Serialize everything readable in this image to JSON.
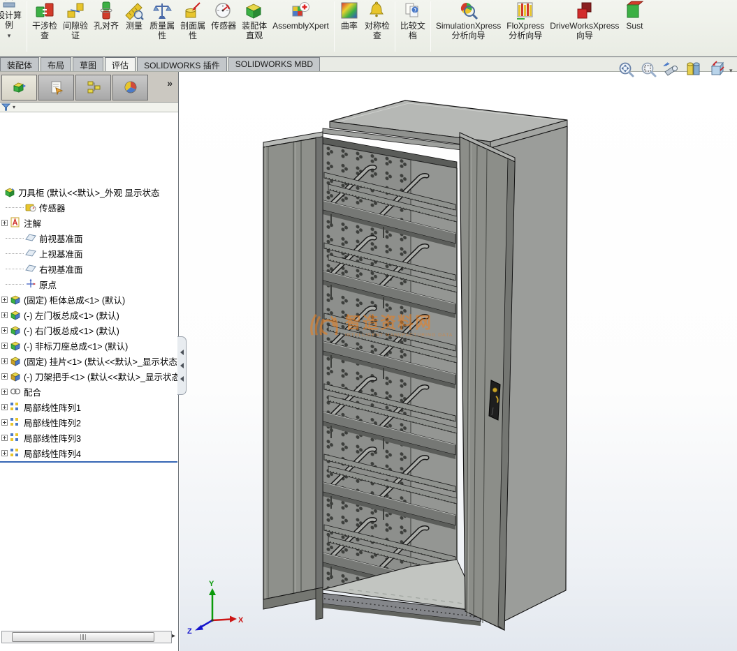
{
  "ribbon": {
    "caret": "▾",
    "items": [
      {
        "label": "设计算\n例"
      },
      {
        "label": "干涉检\n查"
      },
      {
        "label": "间隙验\n证"
      },
      {
        "label": "孔对齐"
      },
      {
        "label": "测量"
      },
      {
        "label": "质量属\n性"
      },
      {
        "label": "剖面属\n性"
      },
      {
        "label": "传感器"
      },
      {
        "label": "装配体\n直观"
      },
      {
        "label": "AssemblyXpert"
      },
      {
        "label": "曲率"
      },
      {
        "label": "对称检\n查"
      },
      {
        "label": "比较文\n档"
      },
      {
        "label": "SimulationXpress\n分析向导"
      },
      {
        "label": "FloXpress\n分析向导"
      },
      {
        "label": "DriveWorksXpress\n向导"
      },
      {
        "label": "Sust"
      }
    ]
  },
  "tabs": {
    "items": [
      "装配体",
      "布局",
      "草图",
      "评估",
      "SOLIDWORKS 插件",
      "SOLIDWORKS MBD"
    ],
    "active": "评估"
  },
  "panel": {
    "overflow_chevron": "»",
    "filter_caret": "▾"
  },
  "tree": {
    "items": [
      {
        "label": "刀具柜 (默认<<默认>_外观 显示状态",
        "icon": "assembly-root",
        "expander": false
      },
      {
        "label": "传感器",
        "icon": "sensors-folder",
        "expander": false
      },
      {
        "label": "注解",
        "icon": "annotations",
        "expander": true
      },
      {
        "label": "前视基准面",
        "icon": "plane",
        "expander": false
      },
      {
        "label": "上视基准面",
        "icon": "plane",
        "expander": false
      },
      {
        "label": "右视基准面",
        "icon": "plane",
        "expander": false
      },
      {
        "label": "原点",
        "icon": "origin",
        "expander": false
      },
      {
        "label": "(固定) 柜体总成<1> (默认)",
        "icon": "subassembly",
        "expander": true
      },
      {
        "label": "(-) 左门板总成<1> (默认)",
        "icon": "subassembly",
        "expander": true
      },
      {
        "label": "(-) 右门板总成<1> (默认)",
        "icon": "subassembly",
        "expander": true
      },
      {
        "label": "(-) 非标刀座总成<1> (默认)",
        "icon": "subassembly",
        "expander": true
      },
      {
        "label": "(固定) 挂片<1> (默认<<默认>_显示状态",
        "icon": "part",
        "expander": true
      },
      {
        "label": "(-) 刀架把手<1> (默认<<默认>_显示状态",
        "icon": "part",
        "expander": true
      },
      {
        "label": "配合",
        "icon": "mates",
        "expander": true
      },
      {
        "label": "局部线性阵列1",
        "icon": "pattern",
        "expander": true
      },
      {
        "label": "局部线性阵列2",
        "icon": "pattern",
        "expander": true
      },
      {
        "label": "局部线性阵列3",
        "icon": "pattern",
        "expander": true
      },
      {
        "label": "局部线性阵列4",
        "icon": "pattern",
        "expander": true
      }
    ]
  },
  "viewport": {
    "watermark": {
      "title": "智造资料网",
      "subtitle": "INTELLIGENT MANUFACTURING DATA"
    },
    "triad": {
      "x": "X",
      "y": "Y",
      "z": "Z"
    },
    "hud_caret": "▾"
  },
  "scrollbar": {
    "right_arrow": "▸"
  },
  "colors": {
    "selection_line": "#3566b4",
    "watermark_orange": "#ef7f1a",
    "cabinet_gray": "#8e908b"
  }
}
